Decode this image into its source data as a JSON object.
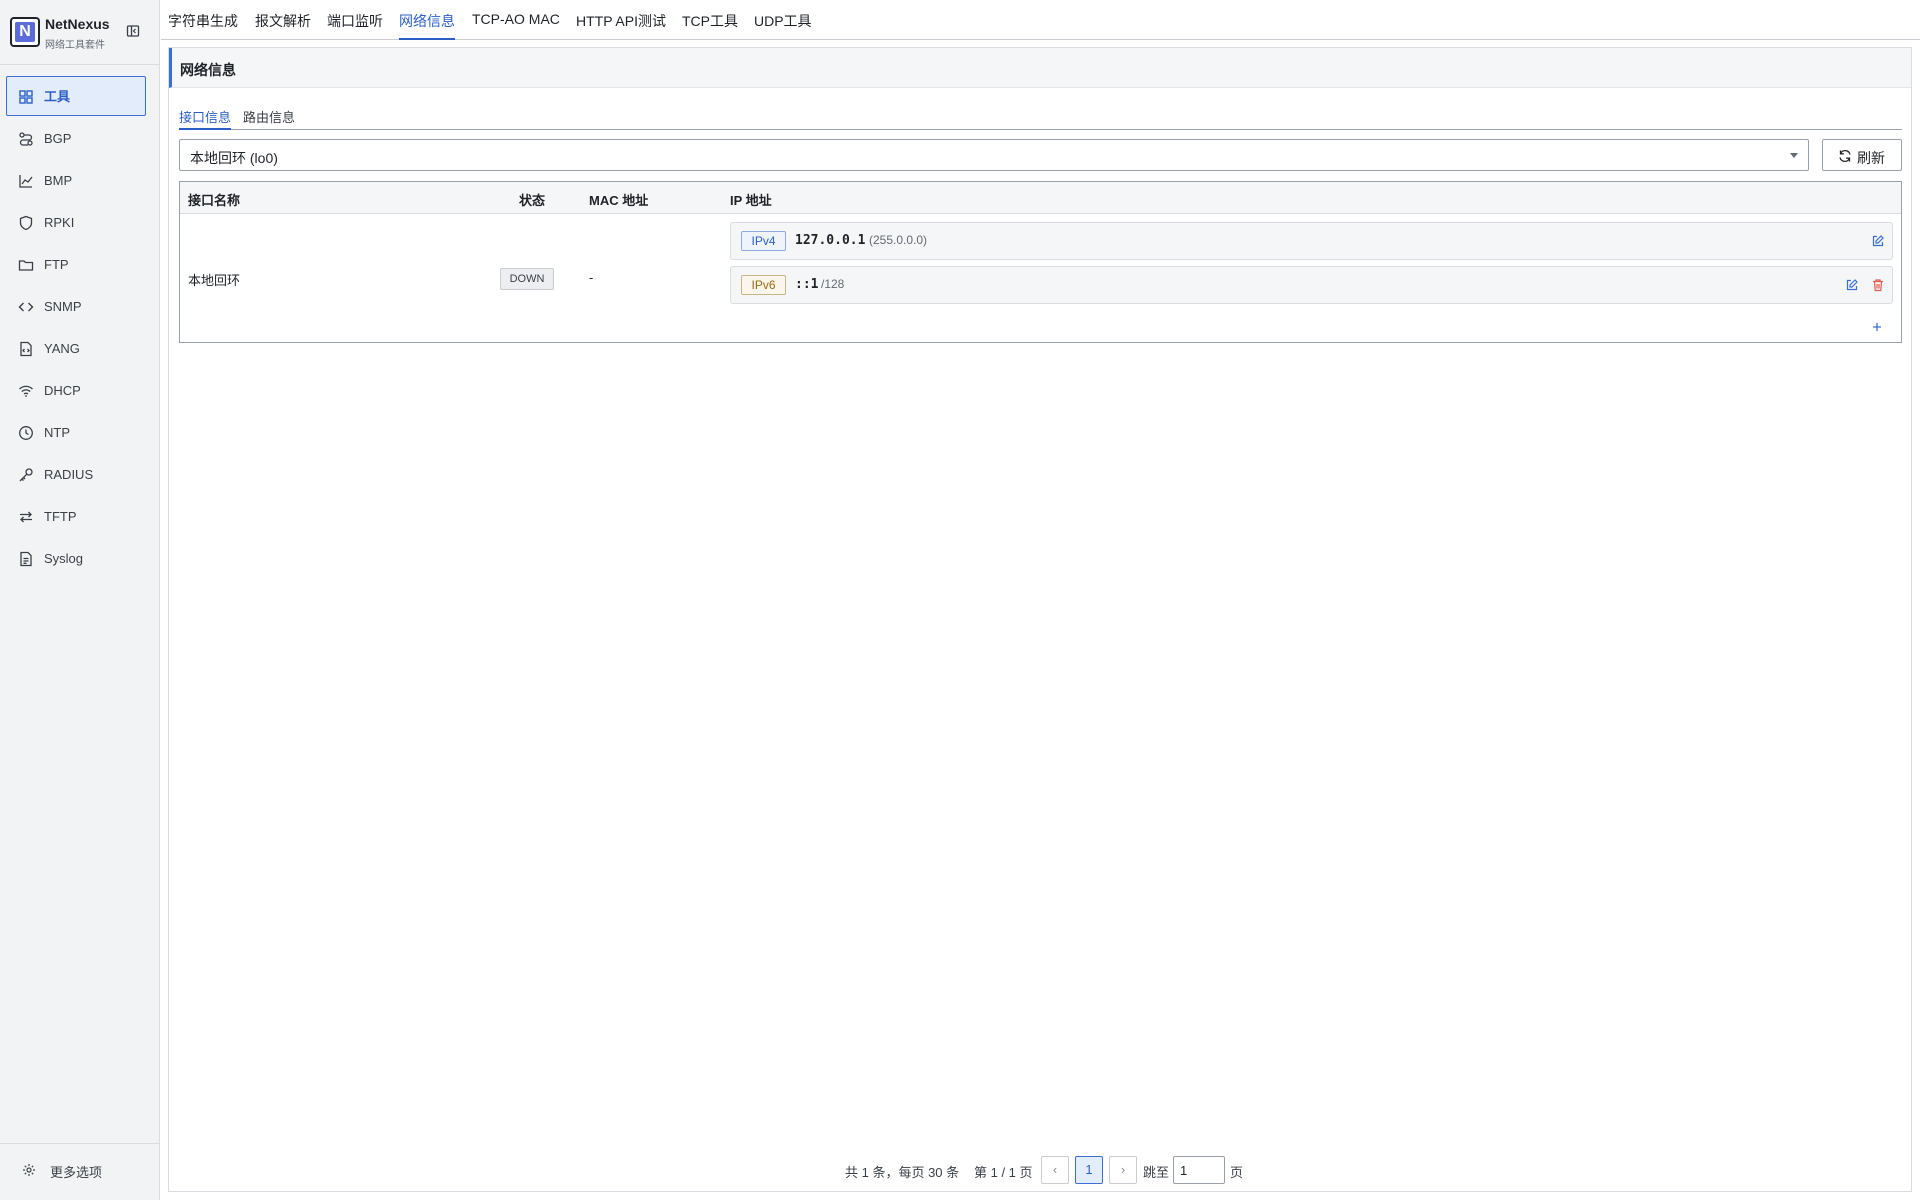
{
  "brand": {
    "name": "NetNexus",
    "subtitle": "网络工具套件",
    "logo_letter": "N"
  },
  "sidebar": {
    "items": [
      {
        "label": "工具",
        "icon": "grid-icon",
        "active": true
      },
      {
        "label": "BGP",
        "icon": "route-icon"
      },
      {
        "label": "BMP",
        "icon": "chart-icon"
      },
      {
        "label": "RPKI",
        "icon": "shield-icon"
      },
      {
        "label": "FTP",
        "icon": "folder-icon"
      },
      {
        "label": "SNMP",
        "icon": "code-icon"
      },
      {
        "label": "YANG",
        "icon": "file-code-icon"
      },
      {
        "label": "DHCP",
        "icon": "wifi-icon"
      },
      {
        "label": "NTP",
        "icon": "clock-icon"
      },
      {
        "label": "RADIUS",
        "icon": "key-icon"
      },
      {
        "label": "TFTP",
        "icon": "transfer-icon"
      },
      {
        "label": "Syslog",
        "icon": "document-icon"
      }
    ],
    "more_label": "更多选项"
  },
  "top_tabs": [
    "字符串生成",
    "报文解析",
    "端口监听",
    "网络信息",
    "TCP-AO MAC",
    "HTTP API测试",
    "TCP工具",
    "UDP工具"
  ],
  "active_top_tab": "网络信息",
  "panel": {
    "title": "网络信息",
    "subtabs": [
      "接口信息",
      "路由信息"
    ],
    "interface_select": "本地回环 (lo0)",
    "refresh_label": "刷新"
  },
  "table": {
    "headers": {
      "name": "接口名称",
      "status": "状态",
      "mac": "MAC 地址",
      "ip": "IP 地址"
    },
    "rows": [
      {
        "name": "本地回环",
        "status": "DOWN",
        "mac": "-",
        "ips": [
          {
            "type": "IPv4",
            "address": "127.0.0.1",
            "mask": "(255.0.0.0)"
          },
          {
            "type": "IPv6",
            "address": "::1",
            "mask": "/128"
          }
        ]
      }
    ],
    "add_symbol": "+"
  },
  "pagination": {
    "summary": "共 1 条，每页 30 条",
    "page_info": "第 1 / 1 页",
    "prev": "‹",
    "current": "1",
    "next": "›",
    "jump_label": "跳至",
    "jump_value": "1",
    "page_suffix": "页"
  },
  "colors": {
    "accent": "#2b5fc7",
    "sidebar_bg": "#f2f3f5",
    "danger": "#e05a4f"
  }
}
